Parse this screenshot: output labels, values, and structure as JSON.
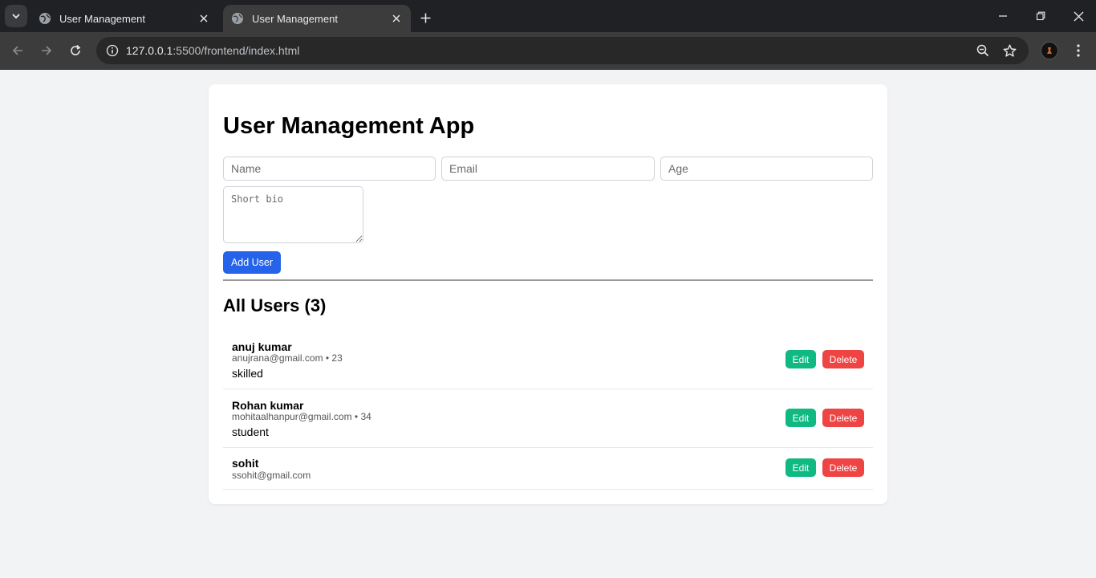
{
  "browser": {
    "tabs": [
      {
        "title": "User Management",
        "active": false,
        "icon": "globe-icon"
      },
      {
        "title": "User Management",
        "active": true,
        "icon": "globe-icon"
      }
    ],
    "url_host": "127.0.0.1",
    "url_rest": ":5500/frontend/index.html"
  },
  "app": {
    "title": "User Management App",
    "form": {
      "name_placeholder": "Name",
      "email_placeholder": "Email",
      "age_placeholder": "Age",
      "bio_placeholder": "Short bio",
      "add_button": "Add User"
    },
    "list_title": "All Users (3)",
    "users": [
      {
        "name": "anuj kumar",
        "meta": "anujrana@gmail.com • 23",
        "bio": "skilled",
        "edit": "Edit",
        "delete": "Delete"
      },
      {
        "name": "Rohan kumar",
        "meta": "mohitaalhanpur@gmail.com • 34",
        "bio": "student",
        "edit": "Edit",
        "delete": "Delete"
      },
      {
        "name": "sohit",
        "meta": "ssohit@gmail.com",
        "bio": "",
        "edit": "Edit",
        "delete": "Delete"
      }
    ]
  },
  "colors": {
    "primary": "#2563eb",
    "edit": "#10b981",
    "delete": "#ef4444",
    "page_bg": "#f2f3f5"
  }
}
